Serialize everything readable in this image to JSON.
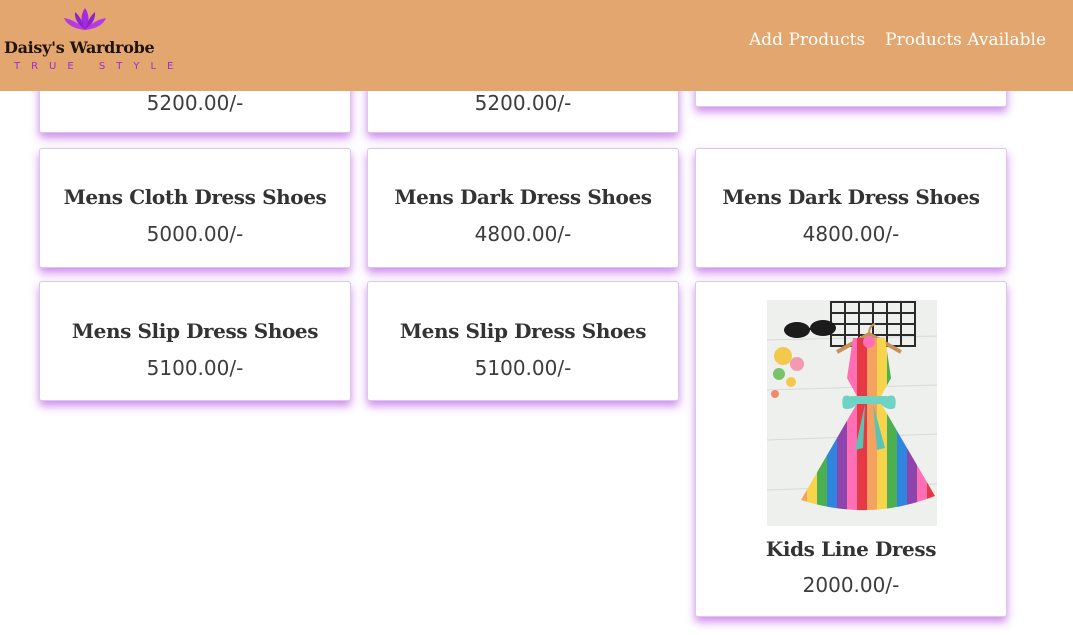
{
  "header": {
    "brand_name": "Daisy's Wardrobe",
    "tagline": "TRUE STYLE",
    "nav": [
      {
        "label": "Add Products"
      },
      {
        "label": "Products Available"
      }
    ]
  },
  "colors": {
    "header_bg": "#e3a66f",
    "card_shadow": "#a82ce2",
    "logo_accent": "#a02ad1"
  },
  "products": [
    {
      "title": "",
      "price": "5200.00/-"
    },
    {
      "title": "",
      "price": "5200.00/-"
    },
    {
      "title": "",
      "price": ""
    },
    {
      "title": "Mens Cloth Dress Shoes",
      "price": "5000.00/-"
    },
    {
      "title": "Mens Dark Dress Shoes",
      "price": "4800.00/-"
    },
    {
      "title": "Mens Dark Dress Shoes",
      "price": "4800.00/-"
    },
    {
      "title": "Mens Slip Dress Shoes",
      "price": "5100.00/-"
    },
    {
      "title": "Mens Slip Dress Shoes",
      "price": "5100.00/-"
    },
    {
      "title": "Kids Line Dress",
      "price": "2000.00/-",
      "image": "striped-rainbow-dress-photo"
    }
  ]
}
